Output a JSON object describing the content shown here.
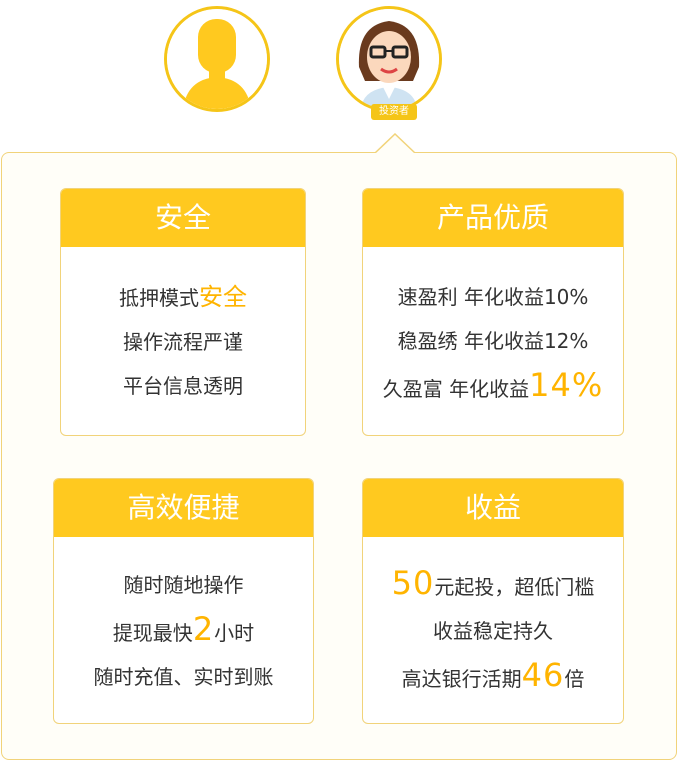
{
  "avatars": {
    "user": {
      "icon": "user-silhouette-icon"
    },
    "investor": {
      "icon": "investor-avatar-icon",
      "badge": "投资者"
    }
  },
  "colors": {
    "accent": "#ffc91f",
    "highlight": "#ffb400",
    "border": "#f1d37a",
    "panel_bg": "#fffef8",
    "text": "#333333"
  },
  "cards": [
    {
      "title": "安全",
      "lines": [
        {
          "prefix": "抵押模式",
          "highlight": "安全",
          "suffix": ""
        },
        {
          "text": "操作流程严谨"
        },
        {
          "text": "平台信息透明"
        }
      ]
    },
    {
      "title": "产品优质",
      "lines": [
        {
          "text": "速盈利 年化收益10%"
        },
        {
          "text": "稳盈绣 年化收益12%"
        },
        {
          "prefix": "久盈富 年化收益",
          "highlight": "14%",
          "suffix": ""
        }
      ]
    },
    {
      "title": "高效便捷",
      "lines": [
        {
          "text": "随时随地操作"
        },
        {
          "prefix": "提现最快",
          "highlight": "2",
          "suffix": "小时"
        },
        {
          "text": "随时充值、实时到账"
        }
      ]
    },
    {
      "title": "收益",
      "lines": [
        {
          "prefix": "",
          "highlight": "50",
          "suffix": "元起投，超低门槛"
        },
        {
          "text": "收益稳定持久"
        },
        {
          "prefix": "高达银行活期",
          "highlight": "46",
          "suffix": "倍"
        }
      ]
    }
  ]
}
